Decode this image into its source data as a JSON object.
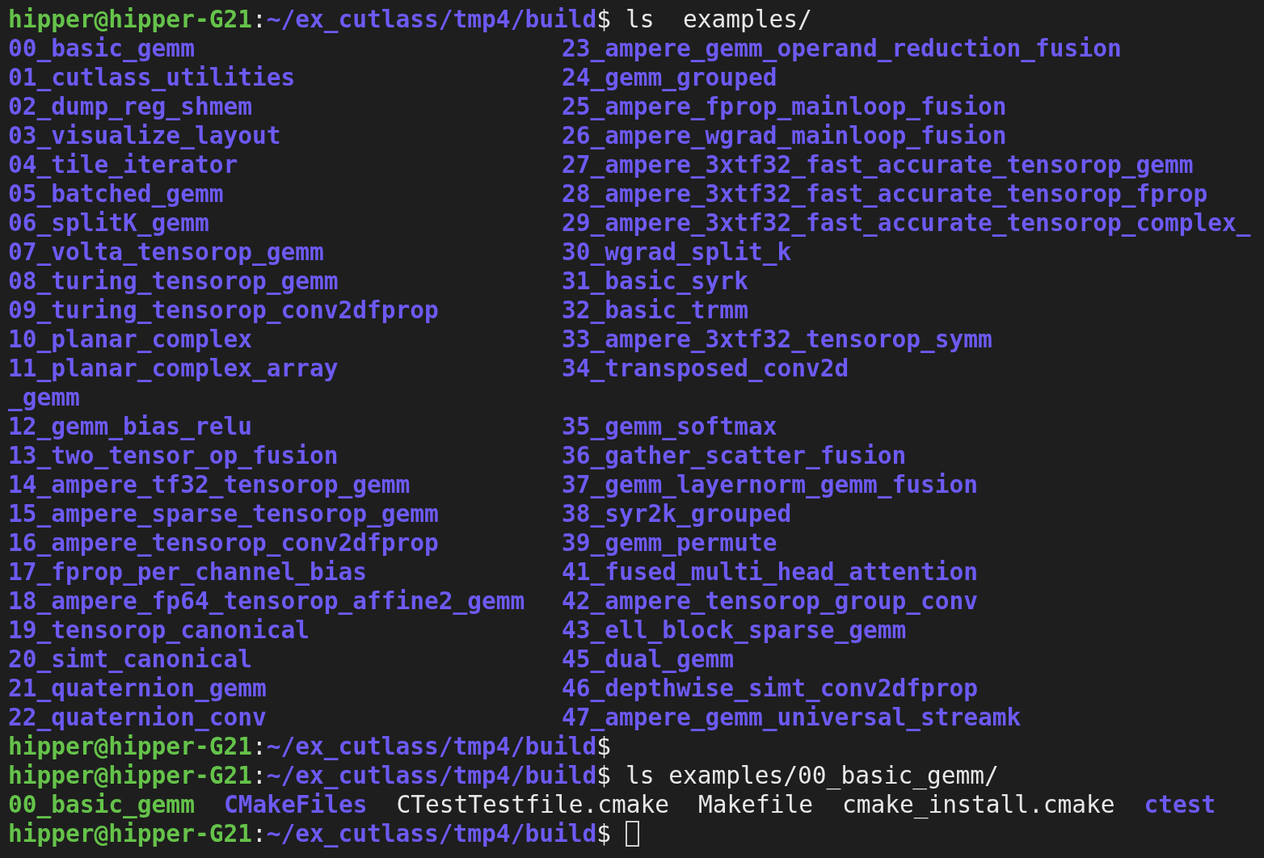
{
  "lines": [
    {
      "kind": "prompt",
      "user_host": "hipper@hipper-G21",
      "separator": ":",
      "path": "~/ex_cutlass/tmp4/build",
      "symbol": "$",
      "command": "ls  examples/",
      "cursor": false
    },
    {
      "kind": "columns",
      "cells": [
        {
          "text": "00_basic_gemm",
          "kind": "dir"
        },
        {
          "text": "23_ampere_gemm_operand_reduction_fusion",
          "kind": "dir"
        }
      ]
    },
    {
      "kind": "columns",
      "cells": [
        {
          "text": "01_cutlass_utilities",
          "kind": "dir"
        },
        {
          "text": "24_gemm_grouped",
          "kind": "dir"
        }
      ]
    },
    {
      "kind": "columns",
      "cells": [
        {
          "text": "02_dump_reg_shmem",
          "kind": "dir"
        },
        {
          "text": "25_ampere_fprop_mainloop_fusion",
          "kind": "dir"
        }
      ]
    },
    {
      "kind": "columns",
      "cells": [
        {
          "text": "03_visualize_layout",
          "kind": "dir"
        },
        {
          "text": "26_ampere_wgrad_mainloop_fusion",
          "kind": "dir"
        }
      ]
    },
    {
      "kind": "columns",
      "cells": [
        {
          "text": "04_tile_iterator",
          "kind": "dir"
        },
        {
          "text": "27_ampere_3xtf32_fast_accurate_tensorop_gemm",
          "kind": "dir"
        }
      ]
    },
    {
      "kind": "columns",
      "cells": [
        {
          "text": "05_batched_gemm",
          "kind": "dir"
        },
        {
          "text": "28_ampere_3xtf32_fast_accurate_tensorop_fprop",
          "kind": "dir"
        }
      ]
    },
    {
      "kind": "columns",
      "cells": [
        {
          "text": "06_splitK_gemm",
          "kind": "dir"
        },
        {
          "text": "29_ampere_3xtf32_fast_accurate_tensorop_complex_",
          "kind": "dir"
        }
      ]
    },
    {
      "kind": "columns",
      "cells": [
        {
          "text": "07_volta_tensorop_gemm",
          "kind": "dir"
        },
        {
          "text": "30_wgrad_split_k",
          "kind": "dir"
        }
      ]
    },
    {
      "kind": "columns",
      "cells": [
        {
          "text": "08_turing_tensorop_gemm",
          "kind": "dir"
        },
        {
          "text": "31_basic_syrk",
          "kind": "dir"
        }
      ]
    },
    {
      "kind": "columns",
      "cells": [
        {
          "text": "09_turing_tensorop_conv2dfprop",
          "kind": "dir"
        },
        {
          "text": "32_basic_trmm",
          "kind": "dir"
        }
      ]
    },
    {
      "kind": "columns",
      "cells": [
        {
          "text": "10_planar_complex",
          "kind": "dir"
        },
        {
          "text": "33_ampere_3xtf32_tensorop_symm",
          "kind": "dir"
        }
      ]
    },
    {
      "kind": "columns",
      "cells": [
        {
          "text": "11_planar_complex_array",
          "kind": "dir"
        },
        {
          "text": "34_transposed_conv2d",
          "kind": "dir"
        }
      ]
    },
    {
      "kind": "columns",
      "cells": [
        {
          "text": "_gemm",
          "kind": "dir"
        }
      ]
    },
    {
      "kind": "columns",
      "cells": [
        {
          "text": "12_gemm_bias_relu",
          "kind": "dir"
        },
        {
          "text": "35_gemm_softmax",
          "kind": "dir"
        }
      ]
    },
    {
      "kind": "columns",
      "cells": [
        {
          "text": "13_two_tensor_op_fusion",
          "kind": "dir"
        },
        {
          "text": "36_gather_scatter_fusion",
          "kind": "dir"
        }
      ]
    },
    {
      "kind": "columns",
      "cells": [
        {
          "text": "14_ampere_tf32_tensorop_gemm",
          "kind": "dir"
        },
        {
          "text": "37_gemm_layernorm_gemm_fusion",
          "kind": "dir"
        }
      ]
    },
    {
      "kind": "columns",
      "cells": [
        {
          "text": "15_ampere_sparse_tensorop_gemm",
          "kind": "dir"
        },
        {
          "text": "38_syr2k_grouped",
          "kind": "dir"
        }
      ]
    },
    {
      "kind": "columns",
      "cells": [
        {
          "text": "16_ampere_tensorop_conv2dfprop",
          "kind": "dir"
        },
        {
          "text": "39_gemm_permute",
          "kind": "dir"
        }
      ]
    },
    {
      "kind": "columns",
      "cells": [
        {
          "text": "17_fprop_per_channel_bias",
          "kind": "dir"
        },
        {
          "text": "41_fused_multi_head_attention",
          "kind": "dir"
        }
      ]
    },
    {
      "kind": "columns",
      "cells": [
        {
          "text": "18_ampere_fp64_tensorop_affine2_gemm",
          "kind": "dir"
        },
        {
          "text": "42_ampere_tensorop_group_conv",
          "kind": "dir"
        }
      ]
    },
    {
      "kind": "columns",
      "cells": [
        {
          "text": "19_tensorop_canonical",
          "kind": "dir"
        },
        {
          "text": "43_ell_block_sparse_gemm",
          "kind": "dir"
        }
      ]
    },
    {
      "kind": "columns",
      "cells": [
        {
          "text": "20_simt_canonical",
          "kind": "dir"
        },
        {
          "text": "45_dual_gemm",
          "kind": "dir"
        }
      ]
    },
    {
      "kind": "columns",
      "cells": [
        {
          "text": "21_quaternion_gemm",
          "kind": "dir"
        },
        {
          "text": "46_depthwise_simt_conv2dfprop",
          "kind": "dir"
        }
      ]
    },
    {
      "kind": "columns",
      "cells": [
        {
          "text": "22_quaternion_conv",
          "kind": "dir"
        },
        {
          "text": "47_ampere_gemm_universal_streamk",
          "kind": "dir"
        }
      ]
    },
    {
      "kind": "prompt",
      "user_host": "hipper@hipper-G21",
      "separator": ":",
      "path": "~/ex_cutlass/tmp4/build",
      "symbol": "$",
      "cursor": false
    },
    {
      "kind": "prompt",
      "user_host": "hipper@hipper-G21",
      "separator": ":",
      "path": "~/ex_cutlass/tmp4/build",
      "symbol": "$",
      "command": "ls examples/00_basic_gemm/",
      "cursor": false
    },
    {
      "kind": "files",
      "entries": [
        {
          "text": "00_basic_gemm",
          "kind": "exec"
        },
        {
          "text": "CMakeFiles",
          "kind": "dir"
        },
        {
          "text": "CTestTestfile.cmake",
          "kind": "file"
        },
        {
          "text": "Makefile",
          "kind": "file"
        },
        {
          "text": "cmake_install.cmake",
          "kind": "file"
        },
        {
          "text": "ctest",
          "kind": "dir"
        }
      ]
    },
    {
      "kind": "prompt",
      "user_host": "hipper@hipper-G21",
      "separator": ":",
      "path": "~/ex_cutlass/tmp4/build",
      "symbol": "$",
      "cursor": true
    }
  ]
}
